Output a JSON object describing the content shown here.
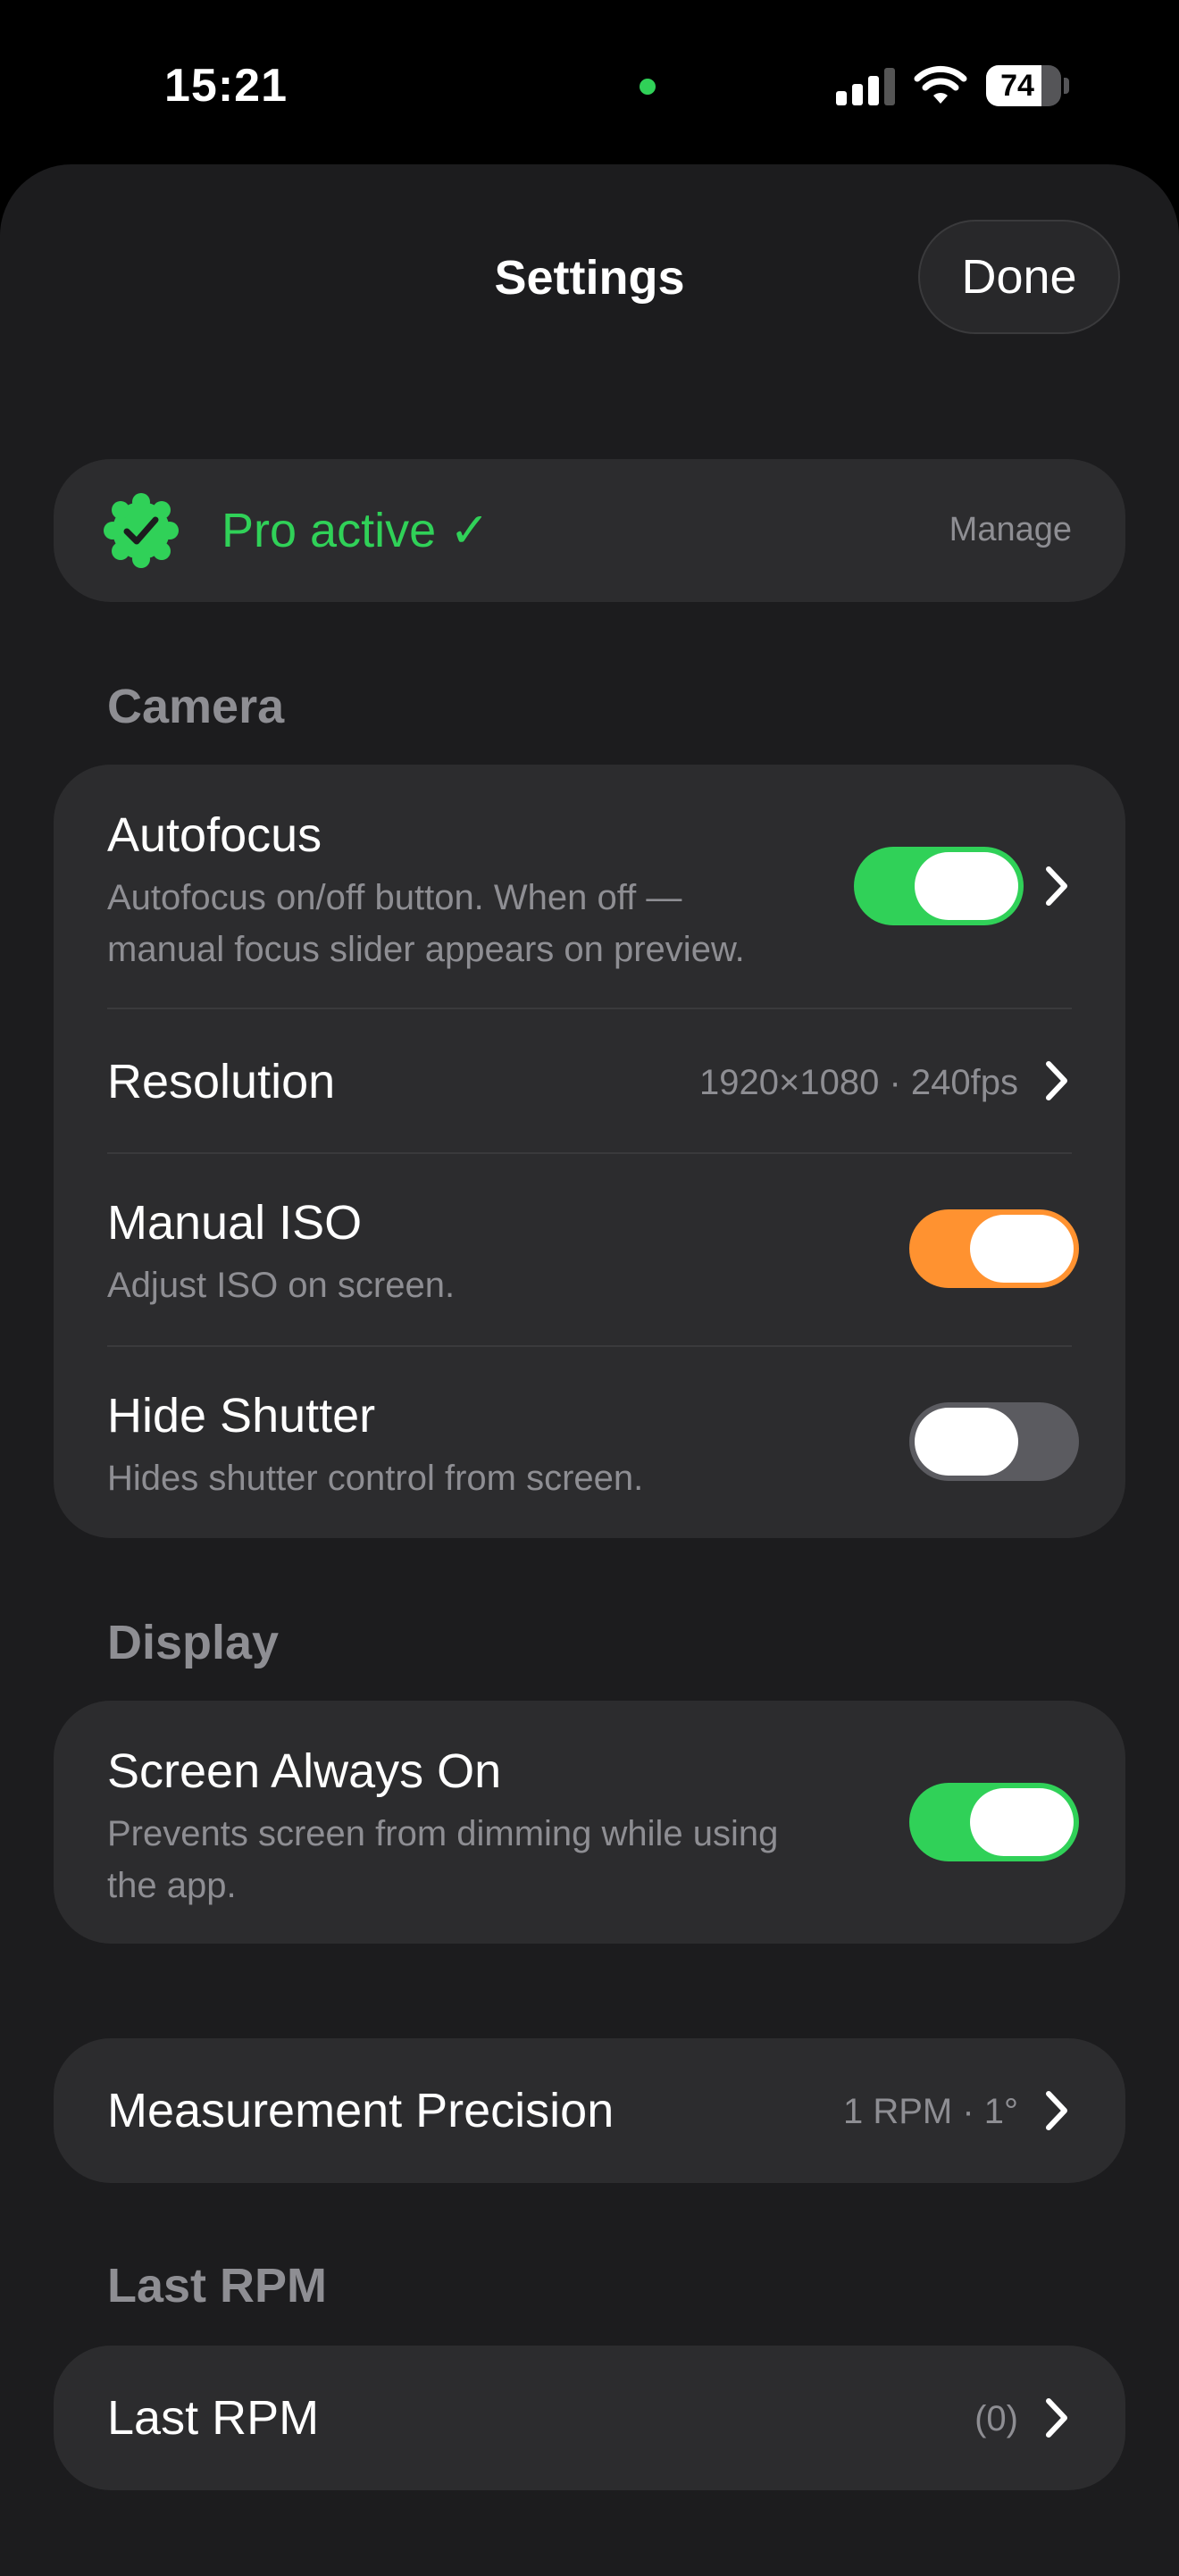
{
  "status_bar": {
    "time": "15:21",
    "battery_level": "74",
    "battery_fraction": 0.74,
    "signal_bars_active": 3,
    "signal_bars_total": 4,
    "camera_indicator_color": "#30d158"
  },
  "header": {
    "title": "Settings",
    "done_label": "Done"
  },
  "pro": {
    "status": "Pro active ✓",
    "manage_label": "Manage",
    "icon": "verified-badge-icon",
    "color": "#30d158"
  },
  "camera": {
    "header": "Camera",
    "autofocus": {
      "title": "Autofocus",
      "subtitle_line1": "Autofocus on/off button. When off —",
      "subtitle_line2": "manual focus slider appears on preview.",
      "enabled": true,
      "color": "#30d158"
    },
    "resolution": {
      "title": "Resolution",
      "value": "1920×1080 · 240fps"
    },
    "manual_iso": {
      "title": "Manual ISO",
      "subtitle": "Adjust ISO on screen.",
      "enabled": true,
      "color": "#ff9230"
    },
    "hide_shutter": {
      "title": "Hide Shutter",
      "subtitle": "Hides shutter control from screen.",
      "enabled": false,
      "color": "#5b5b60"
    }
  },
  "display": {
    "header": "Display",
    "screen_always_on": {
      "title": "Screen Always On",
      "subtitle_line1": "Prevents screen from dimming while using",
      "subtitle_line2": "the app.",
      "enabled": true,
      "color": "#30d158"
    }
  },
  "precision": {
    "title": "Measurement Precision",
    "value": "1 RPM · 1°"
  },
  "last_rpm": {
    "header": "Last RPM",
    "title": "Last RPM",
    "value": "(0)"
  }
}
